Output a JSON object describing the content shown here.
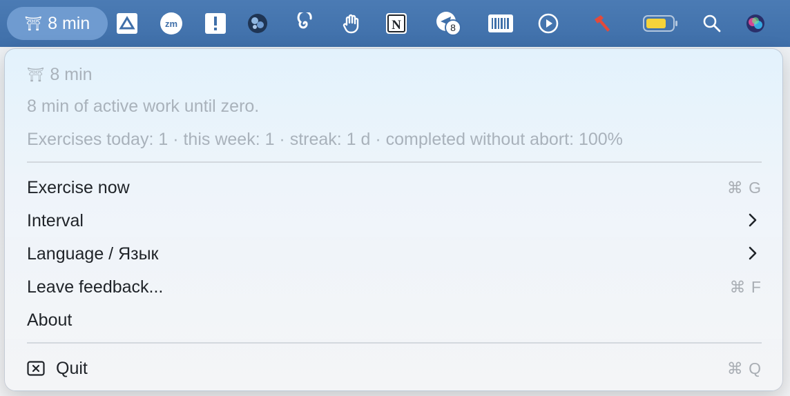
{
  "menubar": {
    "status_label": "8 min",
    "status_icon": "torii-gate-icon",
    "icons": [
      {
        "name": "google-drive-icon"
      },
      {
        "name": "zoom-icon",
        "label": "zm"
      },
      {
        "name": "alert-icon",
        "label": "!"
      },
      {
        "name": "camera-app-icon"
      },
      {
        "name": "spiral-icon"
      },
      {
        "name": "hand-icon"
      },
      {
        "name": "notion-icon",
        "label": "N"
      },
      {
        "name": "telegram-icon",
        "badge": "8"
      },
      {
        "name": "barcode-icon"
      },
      {
        "name": "play-icon"
      },
      {
        "name": "hammer-icon"
      },
      {
        "name": "battery-icon"
      },
      {
        "name": "search-icon"
      },
      {
        "name": "siri-icon"
      }
    ],
    "battery_color": "#f5d33a",
    "accent": "#3f6fa9"
  },
  "menu": {
    "header_title": "8 min",
    "header_icon": "torii-gate-icon",
    "status_line": "8 min of active work until zero.",
    "stats_line": "Exercises today: 1 · this week: 1 · streak: 1 d · completed without abort: 100%",
    "items": [
      {
        "label": "Exercise now",
        "shortcut": "⌘ G"
      },
      {
        "label": "Interval",
        "submenu": true
      },
      {
        "label": "Language / Язык",
        "submenu": true
      },
      {
        "label": "Leave feedback...",
        "shortcut": "⌘ F"
      },
      {
        "label": "About"
      }
    ],
    "quit": {
      "label": "Quit",
      "shortcut": "⌘ Q",
      "icon": "close-box-icon"
    }
  }
}
